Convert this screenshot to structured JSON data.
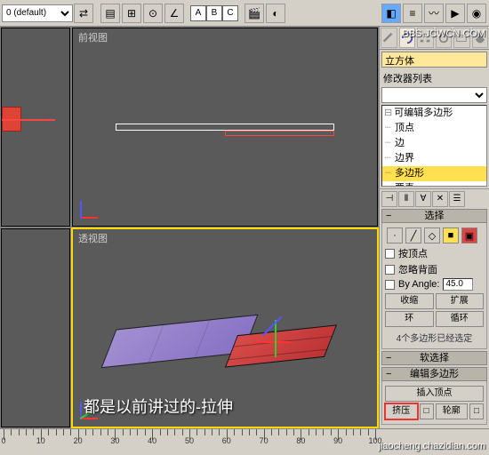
{
  "toolbar": {
    "selection_set": "0 (default)"
  },
  "viewports": {
    "top_left": "",
    "top_right": "前视图",
    "bottom_left": "",
    "bottom_right": "透视图",
    "caption": "都是以前讲过的-拉伸"
  },
  "panel": {
    "object_name": "立方体",
    "modifier_list_label": "修改器列表",
    "stack": {
      "root": "可编辑多边形",
      "items": [
        "顶点",
        "边",
        "边界",
        "多边形",
        "要素"
      ],
      "selected_index": 3
    },
    "selection": {
      "title": "选择",
      "by_vertex": "按顶点",
      "ignore_backface": "忽略背面",
      "by_angle": "By Angle:",
      "angle_value": "45.0",
      "shrink": "收缩",
      "expand": "扩展",
      "ring": "环",
      "loop": "循环",
      "status": "4个多边形已经选定"
    },
    "soft_sel": {
      "title": "软选择"
    },
    "edit_poly": {
      "title": "编辑多边形",
      "insert_vertex": "插入顶点",
      "extrude": "挤压",
      "outline": "轮廓"
    }
  },
  "ruler": {
    "ticks": [
      0,
      10,
      20,
      30,
      40,
      50,
      60,
      70,
      80,
      90,
      100
    ]
  },
  "watermark": {
    "top": "BBS.JCWCN.COM",
    "bottom": "jiaocheng.chazidian.com"
  }
}
